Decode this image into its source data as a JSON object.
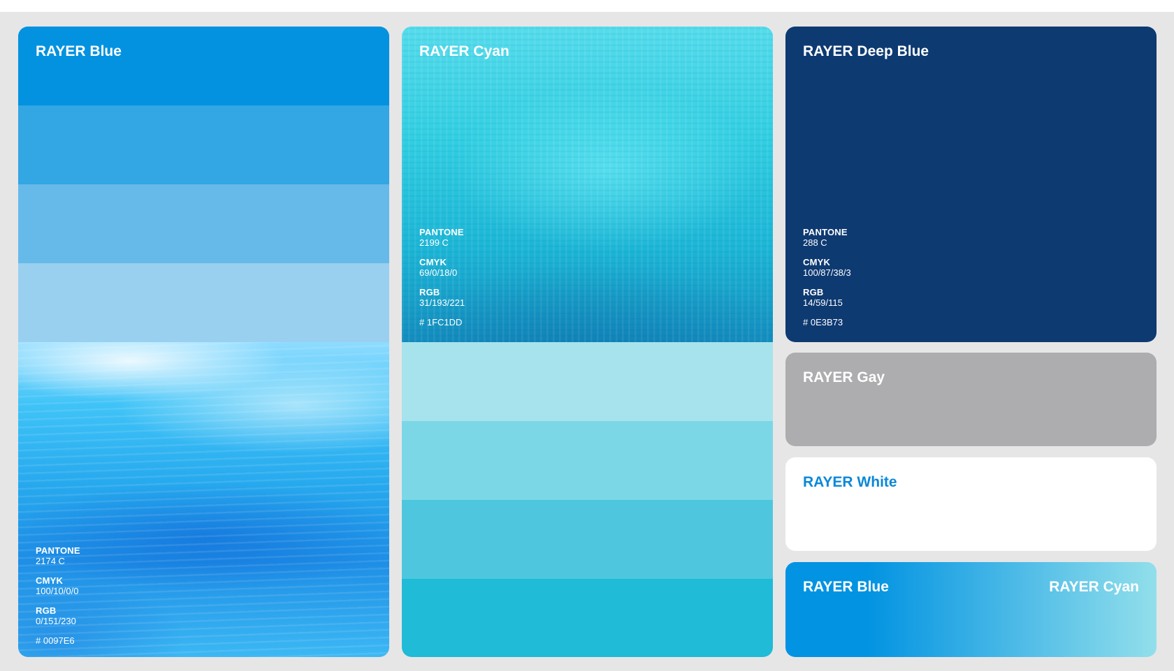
{
  "swatches": {
    "blue": {
      "title": "RAYER Blue",
      "tints": [
        "#0292e0",
        "#33a6e4",
        "#66bae9",
        "#99d0f0"
      ],
      "pantone_label": "PANTONE",
      "pantone": "2174 C",
      "cmyk_label": "CMYK",
      "cmyk": "100/10/0/0",
      "rgb_label": "RGB",
      "rgb": "0/151/230",
      "hex": "# 0097E6"
    },
    "cyan": {
      "title": "RAYER Cyan",
      "tints": [
        "#a7e3ec",
        "#7bd7e6",
        "#4ec7de",
        "#1fbbd7"
      ],
      "pantone_label": "PANTONE",
      "pantone": "2199 C",
      "cmyk_label": "CMYK",
      "cmyk": "69/0/18/0",
      "rgb_label": "RGB",
      "rgb": "31/193/221",
      "hex": "# 1FC1DD"
    },
    "deep_blue": {
      "title": "RAYER Deep Blue",
      "color": "#0e3a72",
      "pantone_label": "PANTONE",
      "pantone": "288 C",
      "cmyk_label": "CMYK",
      "cmyk": "100/87/38/3",
      "rgb_label": "RGB",
      "rgb": "14/59/115",
      "hex": "# 0E3B73"
    },
    "gray": {
      "title": "RAYER Gay",
      "color": "#adadaf"
    },
    "white": {
      "title": "RAYER White",
      "color": "#ffffff",
      "text_color": "#0a88d8"
    },
    "gradient": {
      "title_left": "RAYER Blue",
      "title_right": "RAYER Cyan",
      "from": "#0293e2",
      "to": "#92dfeb"
    }
  }
}
